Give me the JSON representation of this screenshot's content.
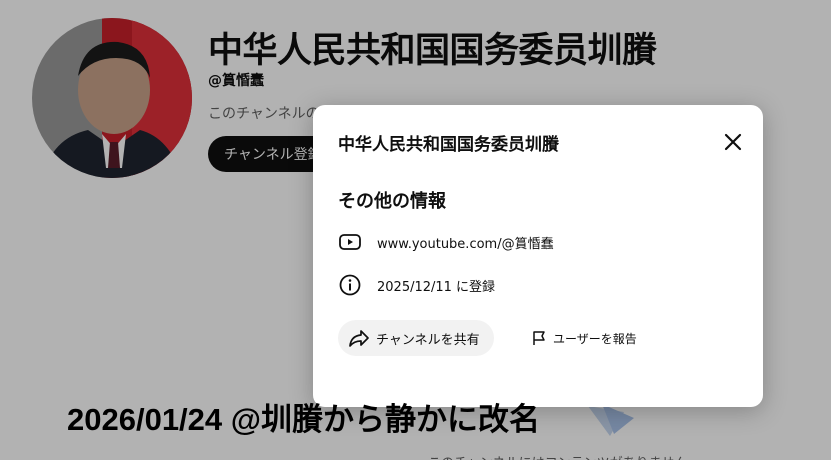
{
  "channel": {
    "title": "中华人民共和国国务委员圳賸",
    "handle": "@篔惛蠢",
    "description": "このチャンネルの",
    "subscribe_label": "チャンネル登録"
  },
  "about_dialog": {
    "title": "中华人民共和国国务委员圳賸",
    "section_title": "その他の情報",
    "url": "www.youtube.com/@篔惛蠢",
    "joined": "2025/12/11 に登録",
    "share_label": "チャンネルを共有",
    "report_label": "ユーザーを報告"
  },
  "background": {
    "empty_note": "このチャンネルにはコンテンツがありません"
  },
  "caption": {
    "text": "2026/01/24 @圳賸から静かに改名"
  },
  "icons": {
    "close": "close-icon",
    "url": "youtube-icon",
    "joined": "info-icon",
    "share": "share-icon",
    "report": "flag-icon"
  },
  "colors": {
    "subscribe_bg": "#0f0f0f",
    "share_bg": "#f2f2f2",
    "backdrop": "rgba(0,0,0,0.30)",
    "avatar_accent": "#c8202a"
  }
}
